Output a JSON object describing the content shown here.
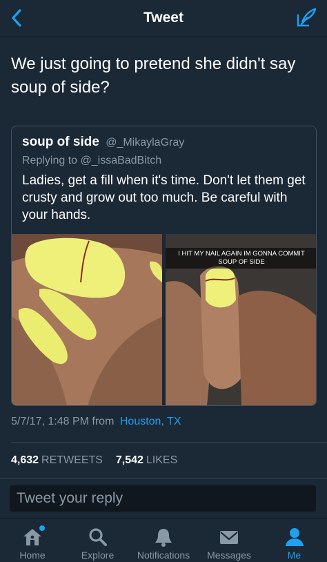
{
  "header": {
    "title": "Tweet",
    "back_icon": "chevron-left-icon",
    "compose_icon": "compose-icon",
    "accent_color": "#1da1f2"
  },
  "tweet": {
    "text": "We just going to pretend she didn't say soup of side?",
    "quoted": {
      "name": "soup of side",
      "handle": "@_MikaylaGray",
      "replying_to": "Replying to @_issaBadBitch",
      "text": "Ladies, get a fill when it's time. Don't let them get crusty and grow out too much. Be careful with your hands.",
      "image_caption": "I HIT MY NAIL AGAIN IM GONNA COMMIT SOUP OF SIDE"
    },
    "timestamp": "5/7/17, 1:48 PM from",
    "location": "Houston, TX",
    "retweets_count": "4,632",
    "retweets_label": "RETWEETS",
    "likes_count": "7,542",
    "likes_label": "LIKES"
  },
  "reply": {
    "placeholder": "Tweet your reply"
  },
  "tabs": [
    {
      "label": "Home",
      "icon": "home-icon",
      "active": false,
      "badge": true
    },
    {
      "label": "Explore",
      "icon": "search-icon",
      "active": false
    },
    {
      "label": "Notifications",
      "icon": "bell-icon",
      "active": false
    },
    {
      "label": "Messages",
      "icon": "envelope-icon",
      "active": false
    },
    {
      "label": "Me",
      "icon": "person-icon",
      "active": true
    }
  ]
}
